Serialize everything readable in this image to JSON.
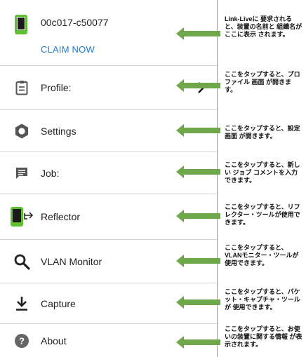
{
  "device": {
    "name": "00c017-c50077",
    "claim_label": "CLAIM NOW"
  },
  "menu": [
    {
      "label": "Profile:",
      "icon": "clipboard-icon"
    },
    {
      "label": "Settings",
      "icon": "gear-icon"
    },
    {
      "label": "Job:",
      "icon": "comment-icon"
    },
    {
      "label": "Reflector",
      "icon": "reflector-icon"
    },
    {
      "label": "VLAN Monitor",
      "icon": "search-icon"
    },
    {
      "label": "Capture",
      "icon": "download-icon"
    },
    {
      "label": "About",
      "icon": "help-icon"
    }
  ],
  "notes": [
    "Link-Liveに 要求されると、装置の名前と 組織名が ここに表示 されます。",
    "ここをタップすると、プロファイル 画面 が開きます。",
    "ここをタップすると、設定 画面 が開きます。",
    "ここをタップすると、新しい ジョブ コメントを入力できます。",
    "ここをタップすると、リフレクター・ツールが使用できます。",
    "ここをタップすると、VLANモニター・ツールが 使用できます。",
    "ここをタップすると、パケット・キャプチャ・ツールが 使用できます。",
    "ここをタップすると、お使いの装置に関する情報 が表示されます。"
  ],
  "colors": {
    "accent": "#1f7fd0",
    "arrow": "#6fa84a",
    "device_icon": "#5fbf32"
  }
}
